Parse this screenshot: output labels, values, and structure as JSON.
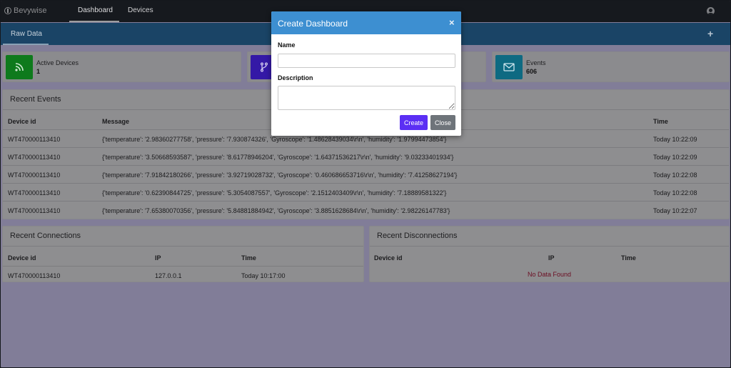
{
  "navbar": {
    "logo_text": "Bevywise",
    "tabs": [
      "Dashboard",
      "Devices"
    ]
  },
  "subbar": {
    "tab_label": "Raw Data",
    "add_label": "+"
  },
  "stats": [
    {
      "label": "Active Devices",
      "value": "1",
      "icon": "rss-icon",
      "color": "#0f8a1f"
    },
    {
      "label": "",
      "value": "",
      "icon": "fork-icon",
      "color": "#3a1fb0"
    },
    {
      "label": "",
      "value": "",
      "icon": "",
      "color": ""
    },
    {
      "label": "Events",
      "value": "606",
      "icon": "envelope-icon",
      "color": "#0f6f8a"
    }
  ],
  "recent_events": {
    "title": "Recent Events",
    "columns": [
      "Device id",
      "Message",
      "Time"
    ],
    "rows": [
      {
        "device": "WT470000113410",
        "message": "{'temperature': '2.98360277758', 'pressure': '7.930874326', 'Gyroscope': '1.48628439034\\r\\n', 'humidity': '1.97994473854'}",
        "time": "Today 10:22:09"
      },
      {
        "device": "WT470000113410",
        "message": "{'temperature': '3.50668593587', 'pressure': '8.61778946204', 'Gyroscope': '1.64371536217\\r\\n', 'humidity': '9.03233401934'}",
        "time": "Today 10:22:09"
      },
      {
        "device": "WT470000113410",
        "message": "{'temperature': '7.91842180266', 'pressure': '3.92719028732', 'Gyroscope': '0.460686653716\\r\\n', 'humidity': '7.41258627194'}",
        "time": "Today 10:22:08"
      },
      {
        "device": "WT470000113410",
        "message": "{'temperature': '0.62390844725', 'pressure': '5.3054087557', 'Gyroscope': '2.1512403409\\r\\n', 'humidity': '7.18889581322'}",
        "time": "Today 10:22:08"
      },
      {
        "device": "WT470000113410",
        "message": "{'temperature': '7.65380070356', 'pressure': '5.84881884942', 'Gyroscope': '3.8851628684\\r\\n', 'humidity': '2.98226147783'}",
        "time": "Today 10:22:07"
      }
    ]
  },
  "recent_connections": {
    "title": "Recent Connections",
    "columns": [
      "Device id",
      "IP",
      "Time"
    ],
    "rows": [
      {
        "device": "WT470000113410",
        "ip": "127.0.0.1",
        "time": "Today 10:17:00"
      }
    ]
  },
  "recent_disconnections": {
    "title": "Recent Disconnections",
    "columns": [
      "Device id",
      "IP",
      "Time"
    ],
    "empty_text": "No Data Found"
  },
  "modal": {
    "title": "Create Dashboard",
    "close_x": "×",
    "name_label": "Name",
    "name_value": "",
    "description_label": "Description",
    "description_value": "",
    "create_label": "Create",
    "close_label": "Close"
  }
}
